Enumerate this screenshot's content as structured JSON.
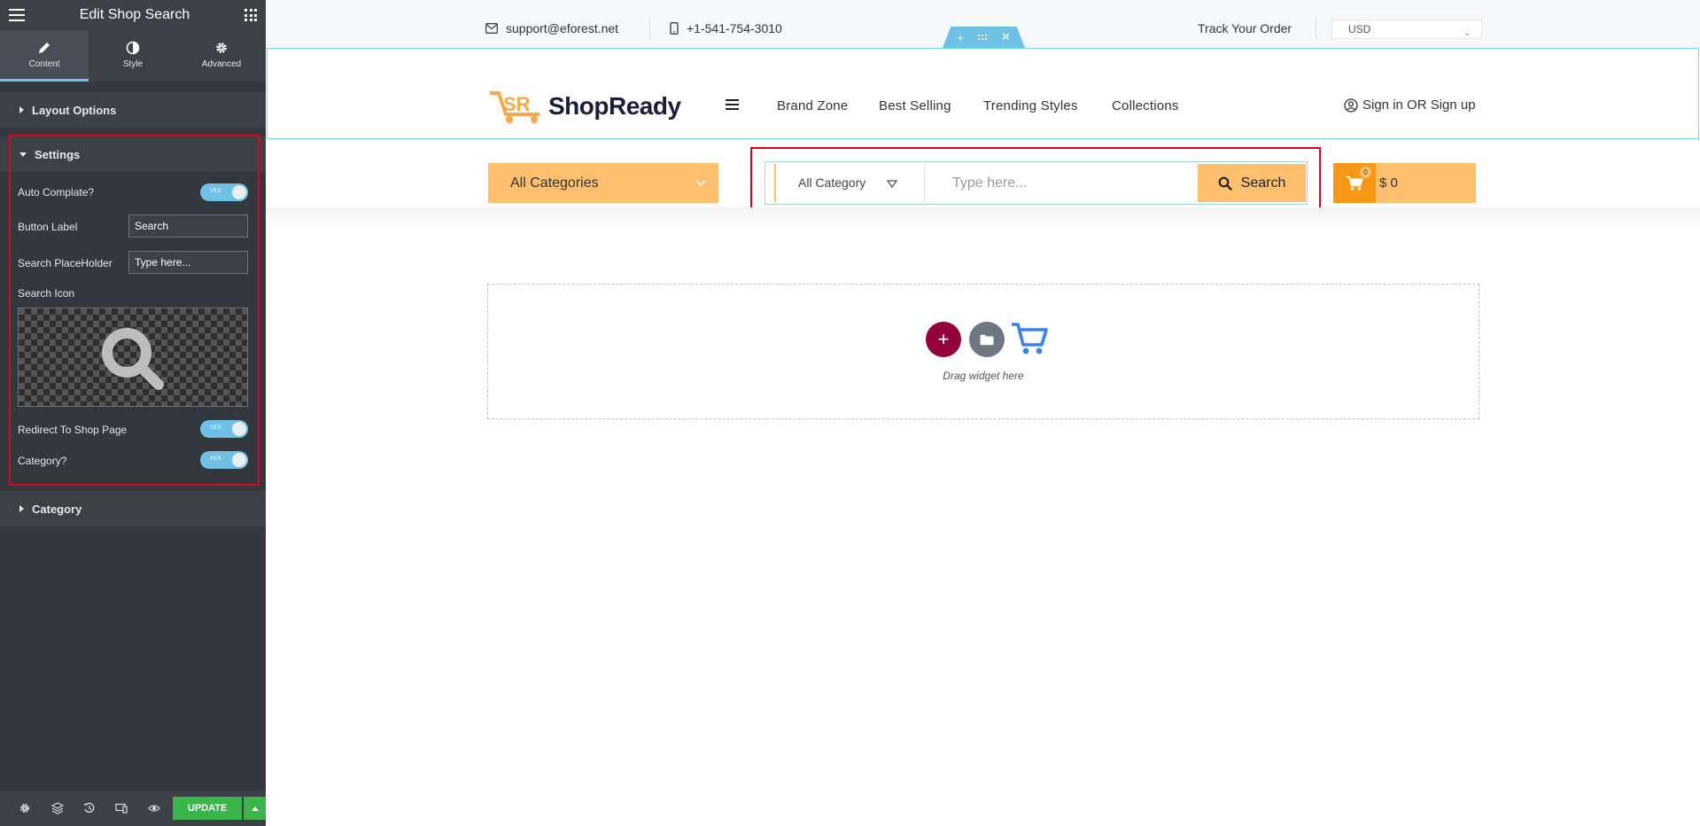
{
  "sidebar": {
    "title": "Edit Shop Search",
    "tabs": [
      {
        "label": "Content"
      },
      {
        "label": "Style"
      },
      {
        "label": "Advanced"
      }
    ],
    "sections": {
      "layout": "Layout Options",
      "settings": "Settings",
      "category": "Category"
    },
    "controls": {
      "auto_complete": "Auto Complate?",
      "button_label": "Button Label",
      "button_label_value": "Search",
      "search_placeholder": "Search PlaceHolder",
      "search_placeholder_value": "Type here...",
      "search_icon": "Search Icon",
      "redirect": "Redirect To Shop Page",
      "category_toggle": "Category?",
      "toggle_on_text": "YES"
    },
    "update_label": "UPDATE",
    "accent_color": "#6ec1e4",
    "update_color": "#39b54a"
  },
  "topbar": {
    "email": "support@eforest.net",
    "phone": "+1-541-754-3010",
    "track": "Track Your Order",
    "currency": "USD"
  },
  "header": {
    "logo": "ShopReady",
    "nav": [
      "Brand Zone",
      "Best Selling",
      "Trending Styles",
      "Collections"
    ],
    "signin": "Sign in OR Sign up"
  },
  "searchbar": {
    "categories_button": "All Categories",
    "category_select": "All Category",
    "placeholder": "Type here...",
    "button": "Search",
    "brand_color": "#fec06e"
  },
  "cart": {
    "count": "0",
    "total": "$ 0"
  },
  "dropzone": {
    "text": "Drag widget here"
  }
}
